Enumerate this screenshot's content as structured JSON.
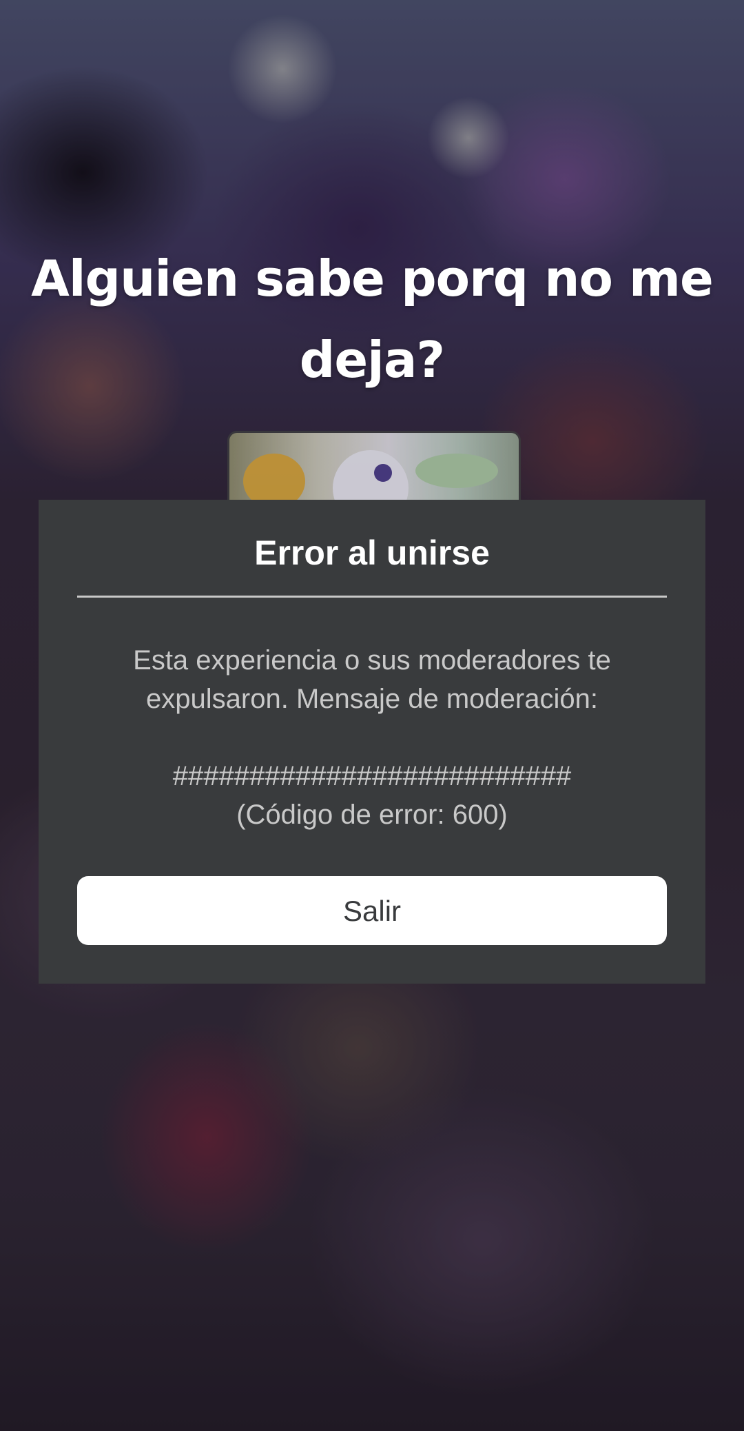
{
  "caption": {
    "line1": "Alguien sabe porq no me",
    "line2": "deja?"
  },
  "dialog": {
    "title": "Error al unirse",
    "message_line1": "Esta experiencia o sus moderadores te",
    "message_line2": "expulsaron. Mensaje de moderación:",
    "moderation_message": "##########################",
    "error_code": "(Código de error: 600)",
    "exit_label": "Salir"
  },
  "colors": {
    "dialog_background": "#393b3d",
    "button_background": "#ffffff",
    "body_text": "#c9c9c9"
  }
}
